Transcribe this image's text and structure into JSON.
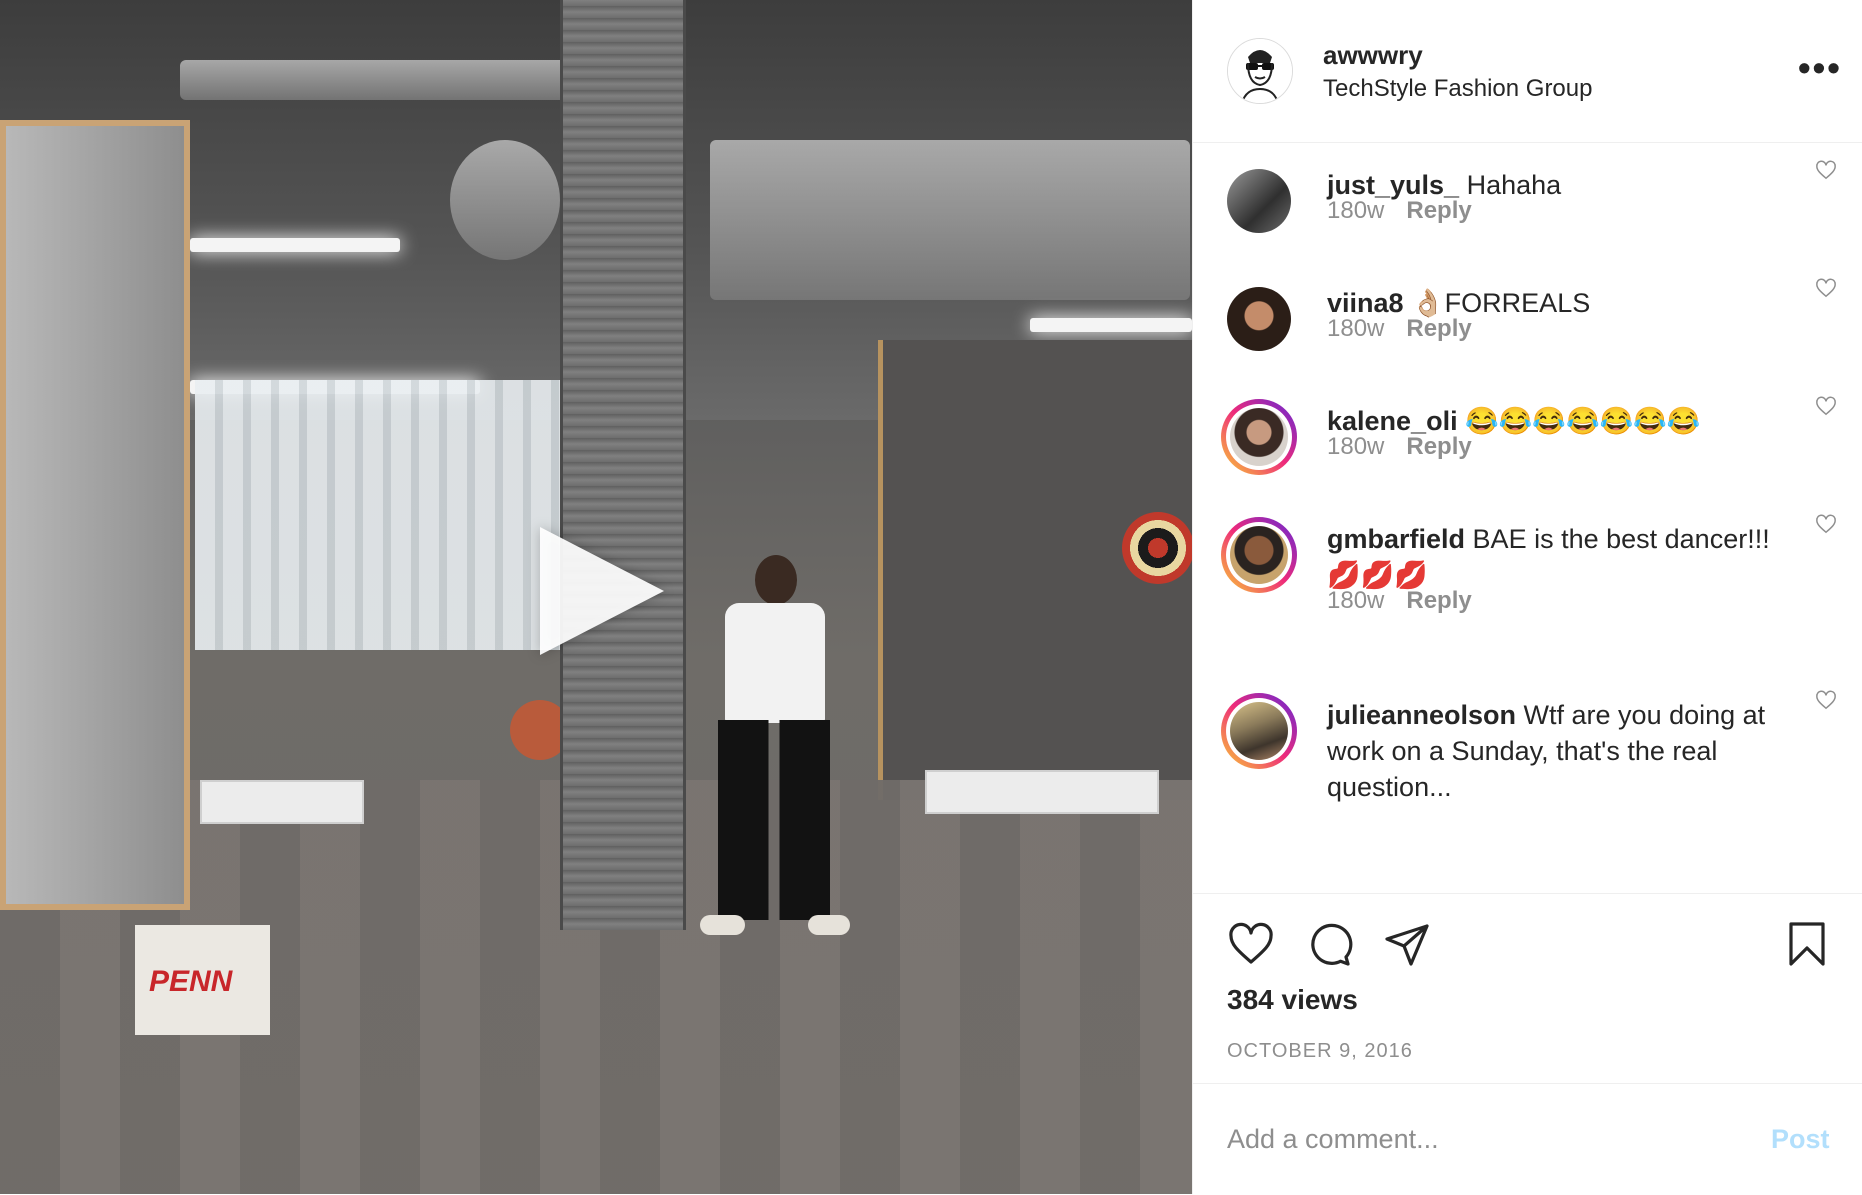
{
  "post": {
    "username": "awwwry",
    "location": "TechStyle Fashion Group",
    "more_icon": "more-horizontal-icon",
    "media": {
      "type": "video",
      "play_icon": "play-icon",
      "box_logo": "PENN"
    }
  },
  "comments": [
    {
      "username": "just_yuls_",
      "text": "Hahaha",
      "time": "180w",
      "reply": "Reply",
      "story_ring": false
    },
    {
      "username": "viina8",
      "text": "👌🏼FORREALS",
      "time": "180w",
      "reply": "Reply",
      "story_ring": false
    },
    {
      "username": "kalene_oli",
      "text": "😂😂😂😂😂😂😂",
      "time": "180w",
      "reply": "Reply",
      "story_ring": true
    },
    {
      "username": "gmbarfield",
      "text": "BAE is the best dancer!!! 💋💋💋",
      "time": "180w",
      "reply": "Reply",
      "story_ring": true
    },
    {
      "username": "julieanneolson",
      "text": "Wtf are you doing at work on a Sunday, that's the real question...",
      "time": "180w",
      "reply": "Reply",
      "story_ring": true
    }
  ],
  "actions": {
    "like_icon": "heart-icon",
    "comment_icon": "comment-bubble-icon",
    "share_icon": "paper-plane-icon",
    "save_icon": "bookmark-icon",
    "views": "384 views",
    "date": "OCTOBER 9, 2016"
  },
  "add_comment": {
    "placeholder": "Add a comment...",
    "post_label": "Post"
  },
  "colors": {
    "text": "#262626",
    "secondary": "#8e8e8e",
    "post_disabled": "#b2dffc",
    "divider": "#efefef"
  }
}
